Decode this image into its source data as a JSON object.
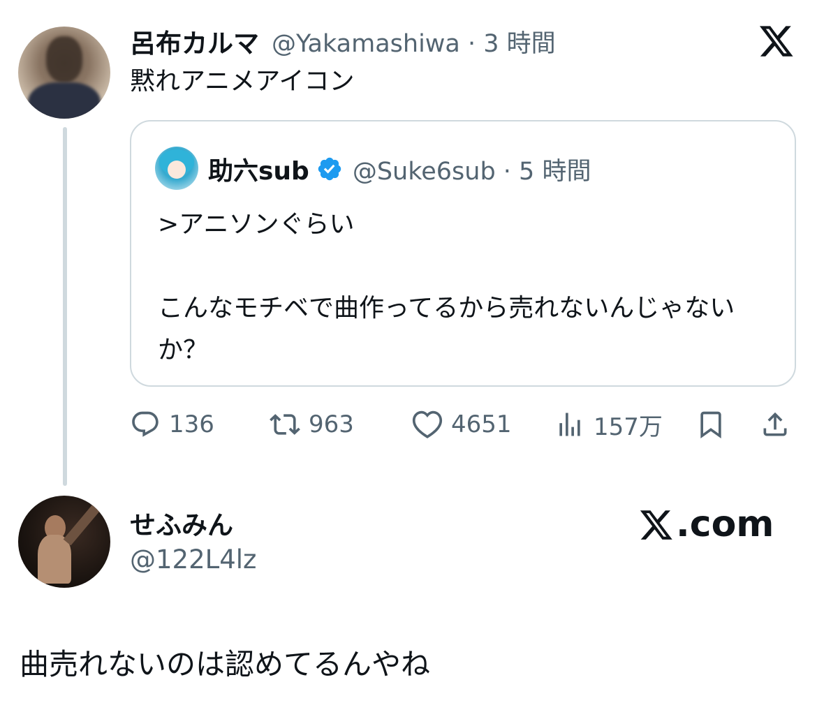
{
  "tweet": {
    "author_name": "呂布カルマ",
    "handle_time": "@Yakamashiwa · 3 時間",
    "text": "黙れアニメアイコン"
  },
  "quote": {
    "author_name": "助六sub",
    "handle_time": "@Suke6sub · 5 時間",
    "text": ">アニソンぐらい\n\nこんなモチベで曲作ってるから売れないんじゃないか？",
    "verified": true
  },
  "actions": {
    "replies": "136",
    "reposts": "963",
    "likes": "4651",
    "views": "157万"
  },
  "reply": {
    "author_name": "せふみん",
    "handle": "@122L4lz",
    "brand": ".com",
    "text": "曲売れないのは認めてるんやね"
  },
  "icons": [
    "x-logo-icon",
    "verified-badge-icon",
    "reply-icon",
    "repost-icon",
    "like-icon",
    "views-icon",
    "bookmark-icon",
    "share-icon"
  ],
  "colors": {
    "text": "#0f1419",
    "muted": "#536471",
    "border": "#cfd9de",
    "verified": "#1d9bf0"
  }
}
